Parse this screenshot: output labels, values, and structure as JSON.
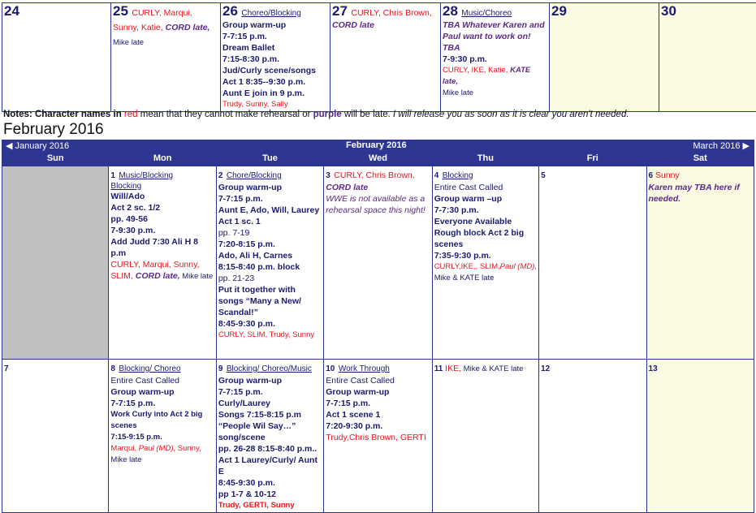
{
  "prev_week": [
    {
      "day": "24",
      "lines": []
    },
    {
      "day": "25",
      "lines": [
        {
          "t": "CURLY",
          "c": "red"
        },
        {
          "t": ", Marqui, Sunny, Katie, ",
          "c": "red"
        },
        {
          "t": "CORD late,",
          "c": "purp",
          "s": "bi"
        },
        {
          "t": " Mike late",
          "c": "navy",
          "s": "sm"
        }
      ]
    },
    {
      "day": "26",
      "head": "Choreo/Blocking",
      "rows": [
        "Group warm-up",
        "7-7:15 p.m.",
        "Dream Ballet",
        "7:15-8:30 p.m.",
        "Jud/Curly scene/songs",
        "Act 1 8:35--9:30 p.m.",
        "Aunt E join in 9 p.m."
      ],
      "tail": "Trudy, Sunny, Sally"
    },
    {
      "day": "27",
      "lines": [
        {
          "t": "CURLY, Chris Brown, ",
          "c": "red"
        },
        {
          "t": "CORD late",
          "c": "purp",
          "s": "bi"
        }
      ]
    },
    {
      "day": "28",
      "head": "Music/Choreo",
      "italic": "TBA Whatever Karen and Paul want to work on! TBA",
      "rows": [
        "7-9:30 p.m."
      ],
      "tail": "CURLY, IKE, Katie, ",
      "tail2": "KATE late,",
      "tail3": "Mike late"
    },
    {
      "day": "29"
    },
    {
      "day": "30"
    }
  ],
  "notes": {
    "label": "Notes: Character names in ",
    "red_word": "red",
    "mid": " mean that they cannot make rehearsal or ",
    "purple_word": "purple",
    "mid2": " will be late. ",
    "italic": "I will release you as soon as it is clear you aren't needed."
  },
  "month_title": "February 2016",
  "nav": {
    "prev": "◀ January 2016",
    "center": "February   2016",
    "next": "March 2016 ▶"
  },
  "weekdays": [
    "Sun",
    "Mon",
    "Tue",
    "Wed",
    "Thu",
    "Fri",
    "Sat"
  ],
  "week1": {
    "mon": {
      "day": "1",
      "head": "Music/Blocking",
      "head2": "Blocking",
      "rows": [
        "Will/Ado",
        "Act 2 sc. 1/2"
      ],
      "plain": "pp. 49-56",
      "rows2": [
        "7-9:30 p.m.",
        "Add Judd 7:30 Ali H 8 p.m"
      ],
      "tail": "CURLY, Marqui, Sunny, SLIM, ",
      "tail2": "CORD late,",
      "tail3": " Mike late"
    },
    "tue": {
      "day": "2",
      "head": "Chore/Blocking",
      "rows": [
        "Group warm-up",
        "7-7:15 p.m.",
        "Aunt E, Ado, Will, Laurey",
        "Act 1 sc. 1"
      ],
      "plain": "pp. 7-19",
      "rows2": [
        "7:20-8:15 p.m.",
        "Ado, Ali H, Carnes",
        "8:15-8:40 p.m. block"
      ],
      "plain2": "pp. 21-23",
      "rows3": [
        "Put it together with songs “Many a New/ Scandal!”",
        "8:45-9:30 p.m."
      ],
      "tail": "CURLY, SLIM, Trudy, Sunny"
    },
    "wed": {
      "day": "3",
      "red": "CURLY, Chris Brown,",
      "cord": "CORD late",
      "italic": "WWE is not available as a rehearsal space this night!"
    },
    "thu": {
      "day": "4",
      "head": "Blocking",
      "plain": "Entire Cast Called",
      "rows": [
        "Group warm –up",
        "7-7:30 p.m.",
        "Everyone Available",
        "Rough block Act 2 big scenes",
        "7:35-9:30 p.m."
      ],
      "tail": " CURLY,IKE,, SLIM,",
      "tail2": "Paul (MD),",
      "tail3": "Mike & KATE  late"
    },
    "fri": {
      "day": "5"
    },
    "sat": {
      "day": "6",
      "red": " Sunny",
      "italic": "Karen may TBA here if needed."
    }
  },
  "week2": {
    "sun": {
      "day": "7"
    },
    "mon": {
      "day": "8",
      "head": "Blocking/ Choreo",
      "plain": "Entire Cast Called",
      "rows": [
        "Group warm-up",
        "7-7:15 p.m.",
        "Work Curly into Act 2 big scenes",
        "7:15-9:15 p.m."
      ],
      "tail": "Marqui, ",
      "tail2": "Paul (MD),",
      "tail3": " Sunny,",
      "tail4": "Mike late"
    },
    "tue": {
      "day": "9",
      "head": "Blocking/ Choreo/Music",
      "rows": [
        "Group warm-up",
        "7-7:15 p.m.",
        "Curly/Laurey",
        "Songs 7:15-8:15 p.m",
        "“People Wil Say…” song/scene",
        "pp. 26-28 8:15-8:40 p.m..",
        "Act 1 Laurey/Curly/ Aunt E",
        "8:45-9:30 p.m.",
        "pp 1-7 & 10-12"
      ],
      "tail": "Trudy,  GERTI,  Sunny"
    },
    "wed": {
      "day": "10",
      "head": "Work Through",
      "plain": "Entire Cast Called",
      "rows": [
        "Group warm-up",
        "7-7:15 p.m.",
        "Act 1 scene 1",
        "7:20-9:30 p.m."
      ],
      "tail": "Trudy,Chris Brown, GERTI"
    },
    "thu": {
      "day": "11",
      "red": " IKE,",
      "rest": " Mike & KATE late"
    },
    "fri": {
      "day": "12"
    },
    "sat": {
      "day": "13"
    }
  },
  "colors": {
    "navy": "#1a1a6e",
    "header_bg": "#2e3691",
    "red": "#e8141c",
    "purple": "#5b2a86",
    "weekend": "#fbfbe3"
  }
}
